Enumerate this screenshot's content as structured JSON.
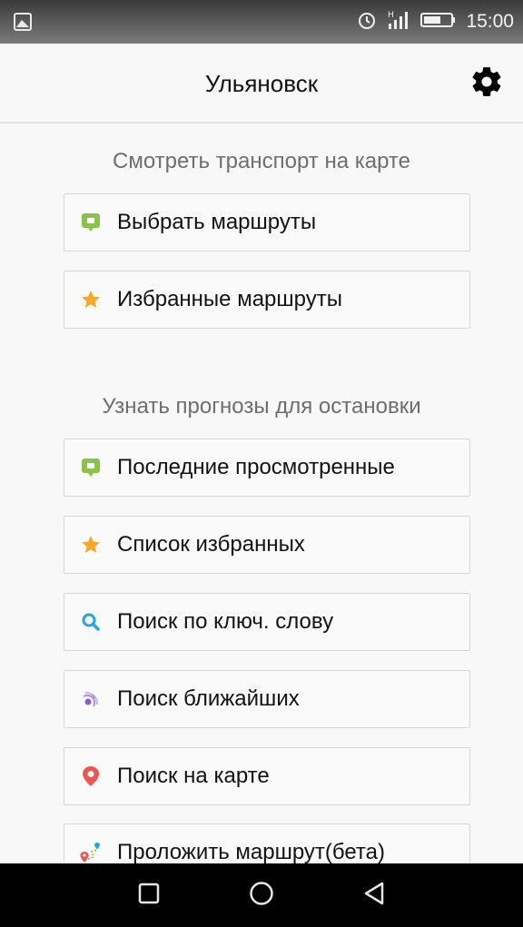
{
  "status_bar": {
    "time": "15:00",
    "icons": [
      "image-icon",
      "alarm-icon",
      "signal-icon",
      "battery-icon"
    ]
  },
  "app_bar": {
    "title": "Ульяновск",
    "settings_icon": "gear-icon"
  },
  "sections": [
    {
      "header": "Смотреть транспорт на карте",
      "items": [
        {
          "label": "Выбрать маршруты",
          "icon": "chat-bubble-icon",
          "color": "#8bc34a"
        },
        {
          "label": "Избранные маршруты",
          "icon": "star-icon",
          "color": "#f9a825"
        }
      ]
    },
    {
      "header": "Узнать прогнозы для остановки",
      "items": [
        {
          "label": "Последние просмотренные",
          "icon": "chat-bubble-icon",
          "color": "#8bc34a"
        },
        {
          "label": "Список избранных",
          "icon": "star-icon",
          "color": "#f9a825"
        },
        {
          "label": "Поиск по ключ. слову",
          "icon": "search-icon",
          "color": "#29a8d8"
        },
        {
          "label": "Поиск ближайших",
          "icon": "nearby-signal-icon",
          "color": "#9c6cd4"
        },
        {
          "label": "Поиск на карте",
          "icon": "map-pin-icon",
          "color": "#ef5350"
        },
        {
          "label": "Проложить маршрут(бета)",
          "icon": "route-icon",
          "color": "#ef5350"
        }
      ]
    }
  ],
  "nav_bar": {
    "buttons": [
      "recent-apps-icon",
      "home-icon",
      "back-icon"
    ]
  }
}
